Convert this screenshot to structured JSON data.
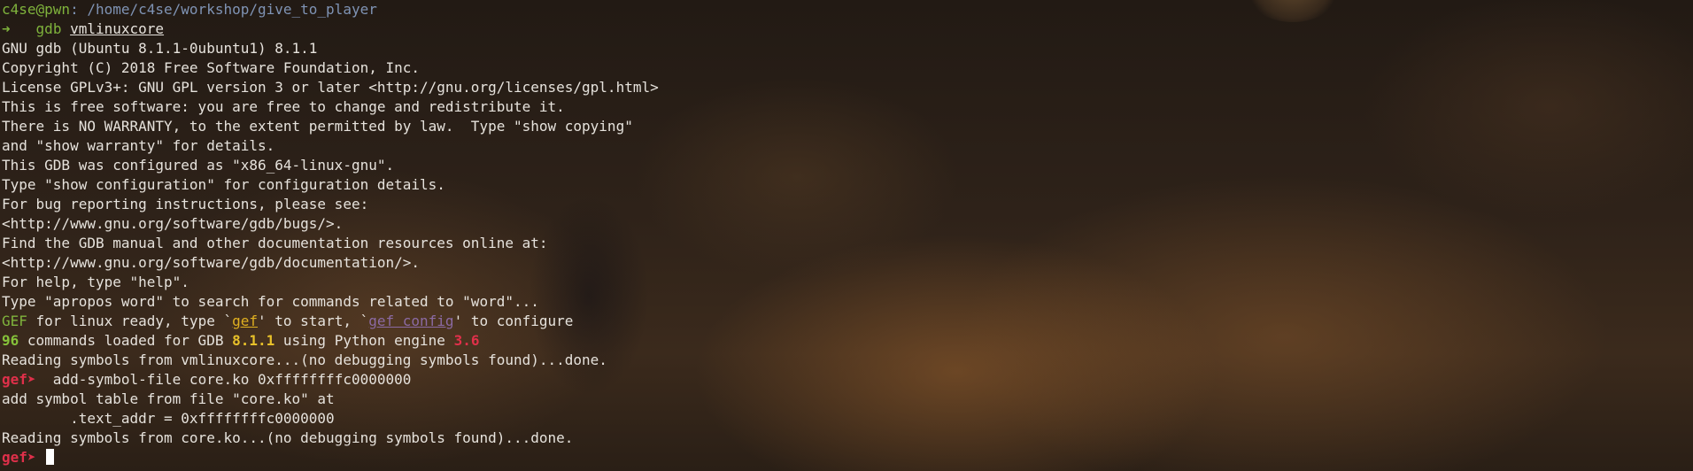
{
  "prompt": {
    "user_host": "c4se@pwn",
    "path": "/home/c4se/workshop/give_to_player",
    "arrow": "➜",
    "command": "gdb",
    "argument": "vmlinuxcore"
  },
  "banner_lines": [
    "GNU gdb (Ubuntu 8.1.1-0ubuntu1) 8.1.1",
    "Copyright (C) 2018 Free Software Foundation, Inc.",
    "License GPLv3+: GNU GPL version 3 or later <http://gnu.org/licenses/gpl.html>",
    "This is free software: you are free to change and redistribute it.",
    "There is NO WARRANTY, to the extent permitted by law.  Type \"show copying\"",
    "and \"show warranty\" for details.",
    "This GDB was configured as \"x86_64-linux-gnu\".",
    "Type \"show configuration\" for configuration details.",
    "For bug reporting instructions, please see:",
    "<http://www.gnu.org/software/gdb/bugs/>.",
    "Find the GDB manual and other documentation resources online at:",
    "<http://www.gnu.org/software/gdb/documentation/>.",
    "For help, type \"help\".",
    "Type \"apropos word\" to search for commands related to \"word\"..."
  ],
  "gef_ready": {
    "gef": "GEF",
    "text1": " for linux ready, type `",
    "gef_cmd": "gef",
    "text2": "' to start, `",
    "gef_config": "gef config",
    "text3": "' to configure"
  },
  "commands_loaded": {
    "count": "96",
    "text1": " commands loaded for GDB ",
    "gdb_version": "8.1.1",
    "text2": " using Python engine ",
    "python_version": "3.6"
  },
  "reading_vmlinux": "Reading symbols from vmlinuxcore...(no debugging symbols found)...done.",
  "gef_prompt": "gef➤ ",
  "add_symbol_command": " add-symbol-file core.ko 0xffffffffc0000000",
  "add_symbol_output": [
    "add symbol table from file \"core.ko\" at",
    "\t.text_addr = 0xffffffffc0000000"
  ],
  "reading_core": "Reading symbols from core.ko...(no debugging symbols found)...done.",
  "colors": {
    "prompt_path": "#7f93b4",
    "arrow_green": "#7fb33c",
    "gef_red": "#e0304a",
    "gef_yellow": "#e0b020",
    "gef_purple": "#8b6aa3"
  }
}
